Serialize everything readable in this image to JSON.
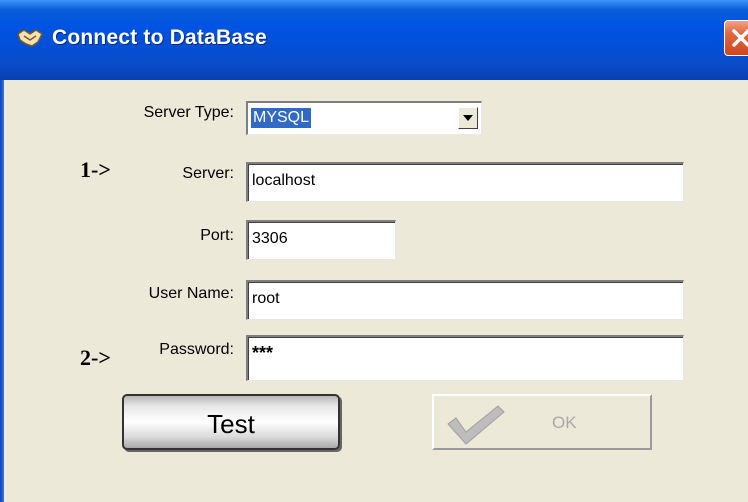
{
  "window": {
    "title": "Connect to DataBase",
    "icon": "handshake-icon",
    "close_icon": "close-icon"
  },
  "form": {
    "server_type": {
      "label": "Server Type:",
      "value": "MYSQL"
    },
    "server": {
      "label": "Server:",
      "value": "localhost"
    },
    "port": {
      "label": "Port:",
      "value": "3306"
    },
    "user_name": {
      "label": "User Name:",
      "value": "root"
    },
    "password": {
      "label": "Password:",
      "value": "***"
    }
  },
  "annotations": {
    "first": "1->",
    "second": "2->"
  },
  "buttons": {
    "test_label": "Test",
    "ok_label": "OK",
    "ok_enabled": false
  },
  "colors": {
    "titlebar": "#0054e3",
    "close": "#e2693f",
    "selection": "#316ac5",
    "background": "#ece9d8"
  }
}
